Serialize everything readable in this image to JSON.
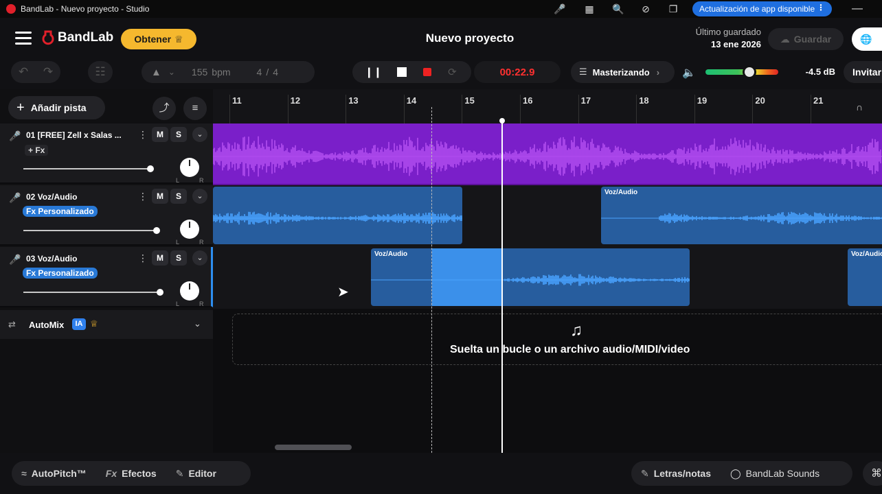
{
  "os_bar": {
    "title": "BandLab - Nuevo proyecto - Studio",
    "update_label": "Actualización de app disponible"
  },
  "header": {
    "brand": "BandLab",
    "get_label": "Obtener",
    "project_title": "Nuevo proyecto",
    "saved_label": "Último guardado",
    "saved_date": "13 ene 2026",
    "save_label": "Guardar"
  },
  "toolbar": {
    "bpm_value": "155",
    "bpm_unit": "bpm",
    "time_sig_num": "4",
    "time_sig_sep": "/",
    "time_sig_den": "4",
    "time": "00:22.9",
    "mastering_label": "Masterizando",
    "volume_db": "-4.5 dB",
    "volume_level": 0.6,
    "invite_label": "Invitar"
  },
  "left": {
    "add_track_label": "Añadir pista"
  },
  "tracks": [
    {
      "name": "01  [FREE] Zell x Salas ...",
      "fx": "+ Fx",
      "mute": "M",
      "solo": "S",
      "volume": 0.87,
      "pan_l": "L",
      "pan_r": "R"
    },
    {
      "name": "02  Voz/Audio",
      "fx": "Fx Personalizado",
      "mute": "M",
      "solo": "S",
      "volume": 0.91,
      "pan_l": "L",
      "pan_r": "R"
    },
    {
      "name": "03  Voz/Audio",
      "fx": "Fx Personalizado",
      "mute": "M",
      "solo": "S",
      "volume": 0.93,
      "pan_l": "L",
      "pan_r": "R"
    }
  ],
  "automix": {
    "label": "AutoMix",
    "badge": "IA"
  },
  "ruler": [
    "11",
    "12",
    "13",
    "14",
    "15",
    "16",
    "17",
    "18",
    "19",
    "20",
    "21"
  ],
  "clips": {
    "voz_label": "Voz/Audio"
  },
  "drop_zone": {
    "text": "Suelta un bucle o un archivo audio/MIDI/video"
  },
  "bottom": {
    "autopitch": "AutoPitch™",
    "efectos": "Efectos",
    "editor": "Editor",
    "letras": "Letras/notas",
    "sounds": "BandLab Sounds"
  },
  "icons": {
    "app": "bandlab-icon",
    "menu": "hamburger-icon",
    "crown": "crown-icon",
    "mic": "microphone-icon",
    "music_add": "music-note-plus-icon"
  },
  "colors": {
    "accent_blue": "#2d8ef0",
    "track1_clip": "#7a1fc9",
    "track2_clip": "#2c6fbf",
    "get_button": "#f5b82e",
    "time_red": "#ff3030"
  }
}
